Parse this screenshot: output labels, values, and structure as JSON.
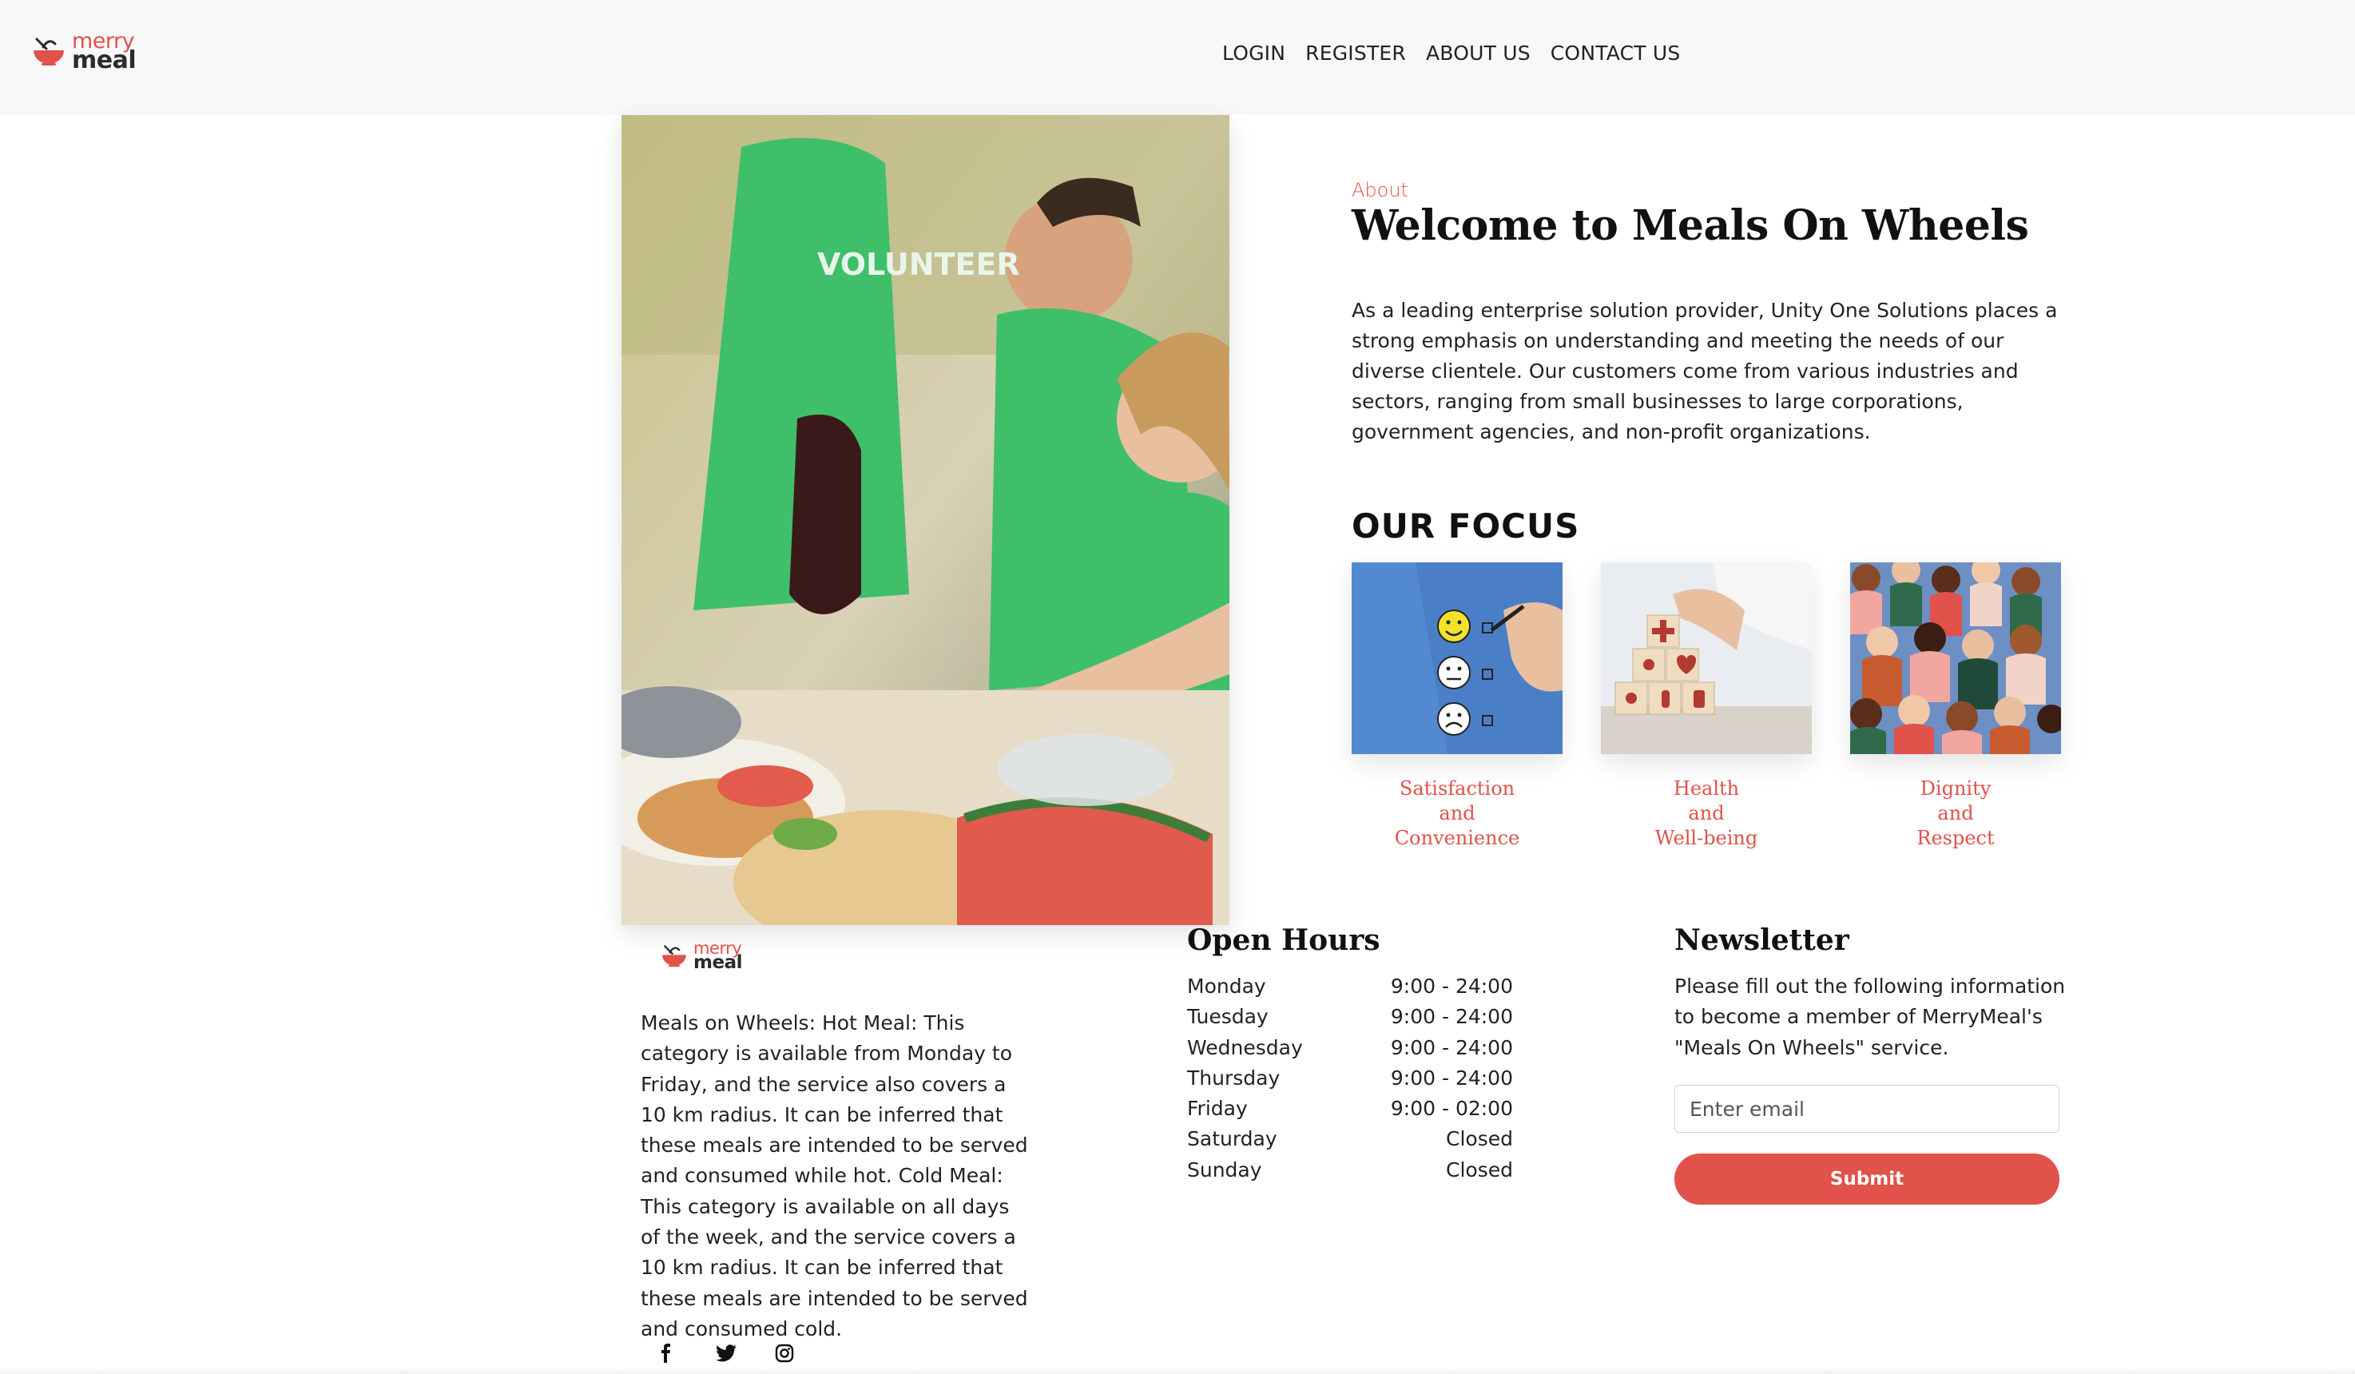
{
  "header": {
    "logo": {
      "line1": "merry",
      "line2": "meal"
    },
    "nav": [
      {
        "label": "LOGIN"
      },
      {
        "label": "REGISTER"
      },
      {
        "label": "ABOUT US"
      },
      {
        "label": "CONTACT US"
      }
    ]
  },
  "hero": {
    "shirt_text": "VOLUNTEER"
  },
  "about": {
    "label": "About",
    "title": "Welcome to Meals On Wheels",
    "body": "As a leading enterprise solution provider, Unity One Solutions places a strong emphasis on understanding and meeting the needs of our diverse clientele. Our customers come from various industries and sectors, ranging from small businesses to large corporations, government agencies, and non-profit organizations."
  },
  "focus": {
    "title": "OUR FOCUS",
    "items": [
      {
        "line1": "Satisfaction",
        "line2": "and",
        "line3": "Convenience"
      },
      {
        "line1": "Health",
        "line2": "and",
        "line3": "Well-being"
      },
      {
        "line1": "Dignity",
        "line2": "and",
        "line3": "Respect"
      }
    ]
  },
  "footer": {
    "logo": {
      "line1": "merry",
      "line2": "meal"
    },
    "description": "Meals on Wheels: Hot Meal: This category is available from Monday to Friday, and the service also covers a 10 km radius. It can be inferred that these meals are intended to be served and consumed while hot. Cold Meal: This category is available on all days of the week, and the service covers a 10 km radius. It can be inferred that these meals are intended to be served and consumed cold.",
    "social": [
      "facebook-icon",
      "twitter-icon",
      "instagram-icon"
    ],
    "hours": {
      "title": "Open Hours",
      "rows": [
        {
          "day": "Monday",
          "time": "9:00 - 24:00"
        },
        {
          "day": "Tuesday",
          "time": "9:00 - 24:00"
        },
        {
          "day": "Wednesday",
          "time": "9:00 - 24:00"
        },
        {
          "day": "Thursday",
          "time": "9:00 - 24:00"
        },
        {
          "day": "Friday",
          "time": "9:00 - 02:00"
        },
        {
          "day": "Saturday",
          "time": "Closed"
        },
        {
          "day": "Sunday",
          "time": "Closed"
        }
      ]
    },
    "newsletter": {
      "title": "Newsletter",
      "text": "Please fill out the following information to become a member of MerryMeal's \"Meals On Wheels\" service.",
      "placeholder": "Enter email",
      "value": "",
      "submit_label": "Submit"
    }
  },
  "colors": {
    "accent": "#e0524a",
    "header_bg": "#f7f8fa",
    "shirt": "#3fbf6a"
  }
}
